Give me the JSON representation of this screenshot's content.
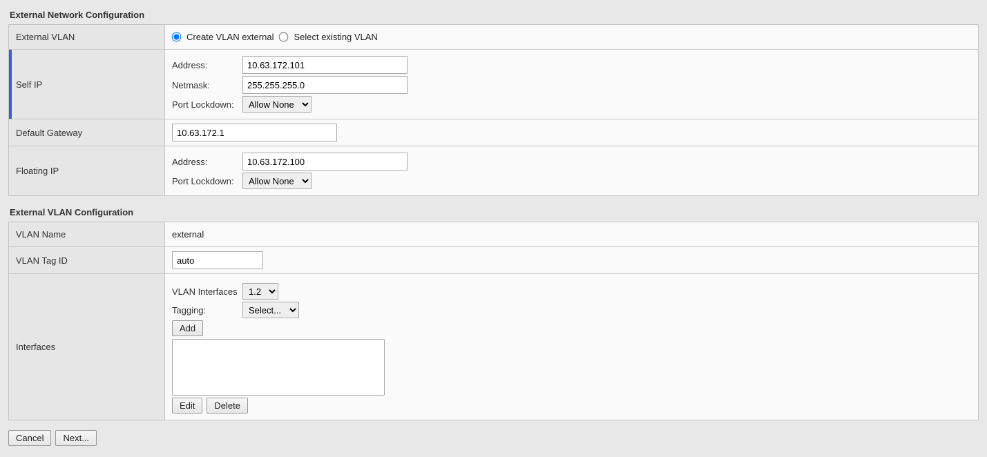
{
  "section1": {
    "title": "External Network Configuration"
  },
  "external_vlan": {
    "row_label": "External VLAN",
    "create_label": "Create VLAN external",
    "select_label": "Select existing VLAN",
    "mode": "create"
  },
  "self_ip": {
    "row_label": "Self IP",
    "address_label": "Address:",
    "address_value": "10.63.172.101",
    "netmask_label": "Netmask:",
    "netmask_value": "255.255.255.0",
    "port_lockdown_label": "Port Lockdown:",
    "port_lockdown_value": "Allow None"
  },
  "default_gateway": {
    "row_label": "Default Gateway",
    "value": "10.63.172.1"
  },
  "floating_ip": {
    "row_label": "Floating IP",
    "address_label": "Address:",
    "address_value": "10.63.172.100",
    "port_lockdown_label": "Port Lockdown:",
    "port_lockdown_value": "Allow None"
  },
  "section2": {
    "title": "External VLAN Configuration"
  },
  "vlan_name": {
    "row_label": "VLAN Name",
    "value": "external"
  },
  "vlan_tag_id": {
    "row_label": "VLAN Tag ID",
    "value": "auto"
  },
  "interfaces": {
    "row_label": "Interfaces",
    "iface_label": "VLAN Interfaces",
    "iface_value": "1.2",
    "tagging_label": "Tagging:",
    "tagging_value": "Select...",
    "add_label": "Add",
    "edit_label": "Edit",
    "delete_label": "Delete"
  },
  "footer": {
    "cancel_label": "Cancel",
    "next_label": "Next..."
  }
}
